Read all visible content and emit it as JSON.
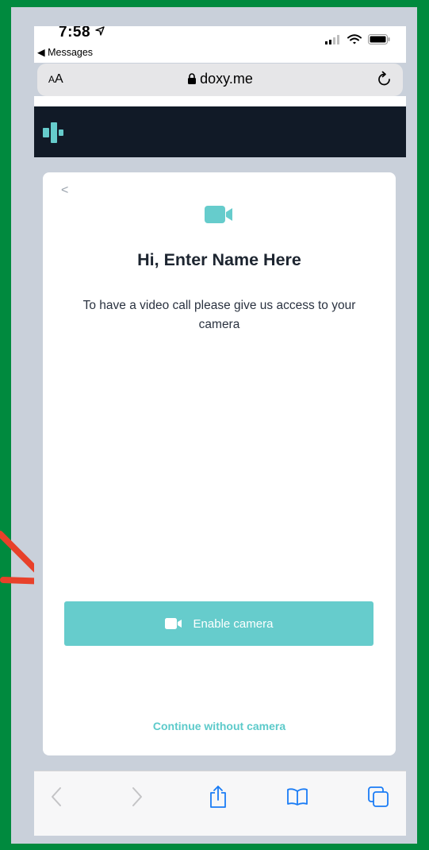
{
  "status": {
    "time": "7:58",
    "back_label": "◀ Messages"
  },
  "browser": {
    "aa_small": "A",
    "aa_large": "A",
    "lock_glyph": "🔒",
    "url": "doxy.me"
  },
  "page": {
    "back_glyph": "<",
    "greeting": "Hi, Enter Name Here",
    "description": "To have a video call please give us access to your camera",
    "enable_camera_label": "Enable camera",
    "continue_label": "Continue without camera"
  },
  "colors": {
    "accent": "#66cccc",
    "header_bg": "#111a27",
    "outer_border": "#008a3e",
    "annotation_arrow": "#e8412a"
  }
}
